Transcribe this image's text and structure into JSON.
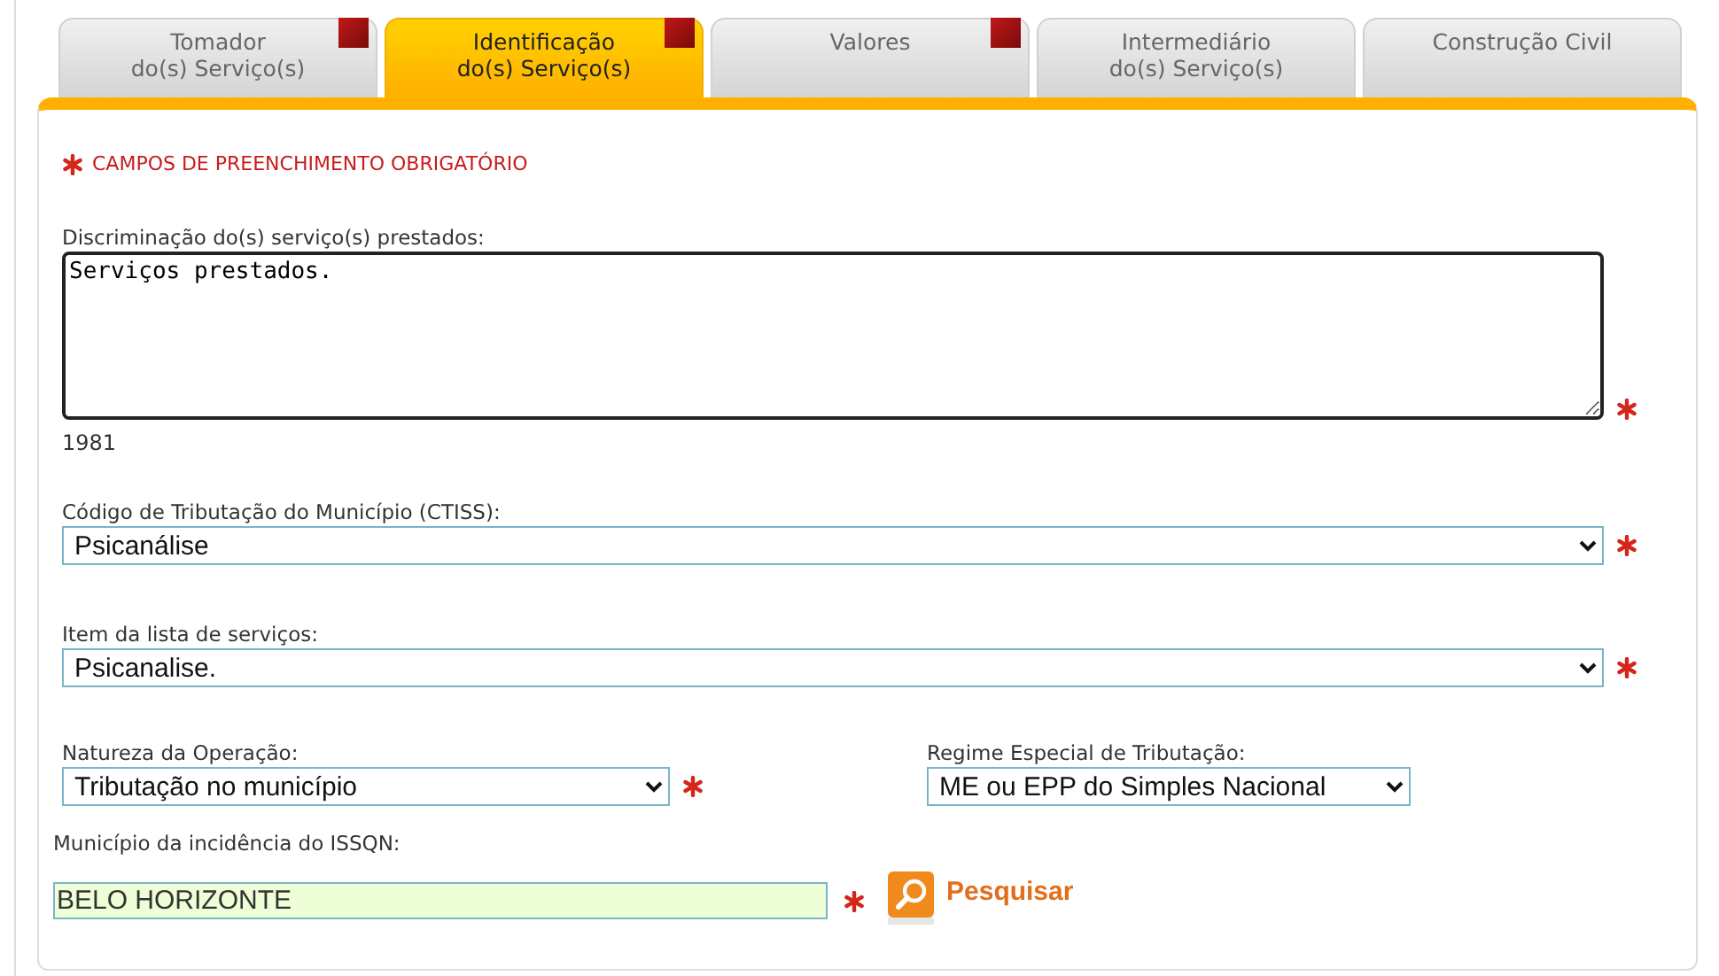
{
  "tabs": [
    {
      "lines": [
        "Tomador",
        "do(s) Serviço(s)"
      ],
      "selected": false,
      "flagged": true
    },
    {
      "lines": [
        "Identificação",
        "do(s) Serviço(s)"
      ],
      "selected": true,
      "flagged": true
    },
    {
      "lines": [
        "Valores"
      ],
      "selected": false,
      "flagged": true
    },
    {
      "lines": [
        "Intermediário",
        "do(s) Serviço(s)"
      ],
      "selected": false,
      "flagged": false
    },
    {
      "lines": [
        "Construção Civil"
      ],
      "selected": false,
      "flagged": false
    }
  ],
  "required_note": "CAMPOS DE PREENCHIMENTO OBRIGATÓRIO",
  "description": {
    "label": "Discriminação do(s) serviço(s) prestados:",
    "value": "Serviços prestados.",
    "counter": "1981",
    "required": true
  },
  "full_selects": [
    {
      "label": "Código de Tributação do Município (CTISS):",
      "value": "Psicanálise",
      "required": true
    },
    {
      "label": "Item da lista de serviços:",
      "value": "Psicanalise.",
      "required": true
    }
  ],
  "half_selects": [
    {
      "label": "Natureza da Operação:",
      "value": "Tributação no município",
      "required": true
    },
    {
      "label": "Regime Especial de Tributação:",
      "value": "ME ou EPP do Simples Nacional",
      "required": false
    }
  ],
  "municipality": {
    "label": "Município da incidência do ISSQN:",
    "value": "BELO HORIZONTE",
    "required": true,
    "search_label": "Pesquisar"
  }
}
